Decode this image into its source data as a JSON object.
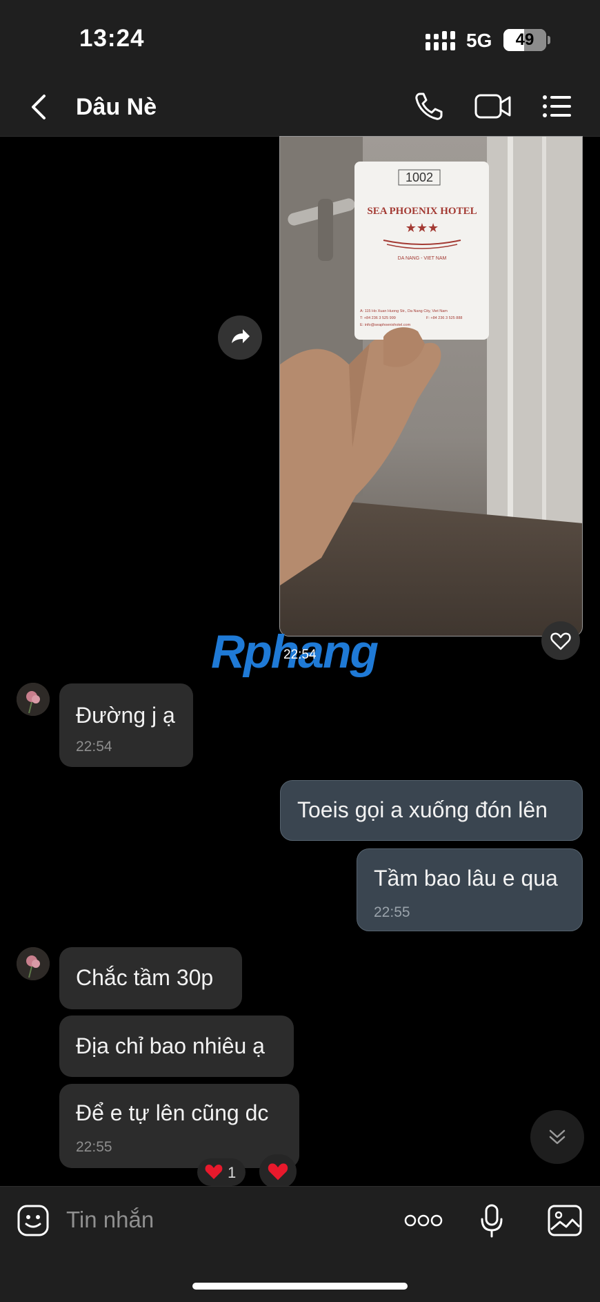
{
  "status_bar": {
    "time": "13:24",
    "network": "5G",
    "battery_percent": 49,
    "battery_text": "49"
  },
  "header": {
    "title": "Dâu Nè",
    "back_icon": "chevron-left-icon",
    "call_icon": "phone-icon",
    "video_icon": "video-camera-icon",
    "menu_icon": "list-icon"
  },
  "media_message": {
    "time": "22:54",
    "card": {
      "room": "1002",
      "hotel": "SEA PHOENIX HOTEL",
      "stars": "★★★",
      "city": "DA NANG - VIET NAM",
      "address": "A: 115 Ho Xuan Huong Str., Da Nang City, Viet Nam",
      "phone": "T: +84 236 3 525 999",
      "fax": "F: +84 236 3 525 888",
      "email": "E: info@seaphoenixhotel.com"
    }
  },
  "watermark": "Rphang",
  "messages": [
    {
      "text": "Đường j ạ",
      "time": "22:54"
    },
    {
      "text": "Toeis gọi a xuống đón lên"
    },
    {
      "text": "Tầm bao lâu e qua",
      "time": "22:55"
    },
    {
      "text": "Chắc tầm 30p"
    },
    {
      "text": "Địa chỉ bao nhiêu ạ"
    },
    {
      "text": "Để e tự lên cũng dc",
      "time": "22:55"
    }
  ],
  "reactions": {
    "heart_count": "1"
  },
  "composer": {
    "placeholder": "Tin nhắn"
  },
  "colors": {
    "background": "#000000",
    "bar": "#1f1f1f",
    "incoming_bubble": "#2c2c2c",
    "outgoing_bubble": "#3a4550",
    "heart": "#e8192c"
  }
}
